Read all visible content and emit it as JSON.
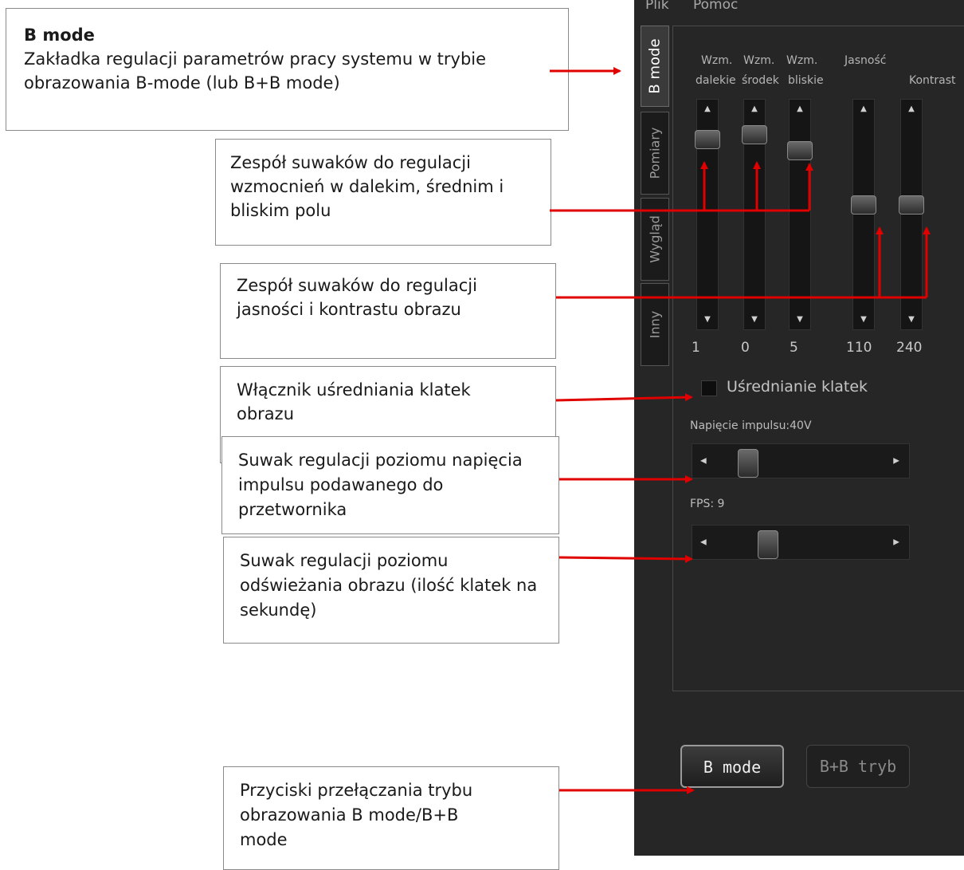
{
  "menu": {
    "file": "Plik",
    "help": "Pomoc"
  },
  "tabs": [
    "B mode",
    "Pomiary",
    "Wygląd",
    "Inny"
  ],
  "sliders": {
    "headers": {
      "far1": "Wzm.",
      "far2": "dalekie",
      "mid1": "Wzm.",
      "mid2": "środek",
      "near1": "Wzm.",
      "near2": "bliskie",
      "brightness": "Jasność",
      "contrast": "Kontrast"
    },
    "values": [
      "1",
      "0",
      "5",
      "110",
      "240"
    ]
  },
  "averaging": {
    "label": "Uśrednianie klatek",
    "checked": false
  },
  "pulse": {
    "label": "Napięcie impulsu:40V"
  },
  "fps": {
    "label": "FPS: 9"
  },
  "buttons": {
    "bmode": "B mode",
    "bbmode": "B+B tryb"
  },
  "callouts": {
    "bmode_title": "B mode",
    "bmode_text": "Zakładka regulacji parametrów pracy systemu w trybie obrazowania B-mode (lub B+B mode)",
    "gain": "Zespół suwaków do regulacji wzmocnień w dalekim, średnim i bliskim polu",
    "bright": "Zespół suwaków do regulacji jasności i kontrastu obrazu",
    "avg": "Włącznik uśredniania klatek obrazu",
    "pulse": "Suwak regulacji poziomu napięcia impulsu podawanego do przetwornika",
    "fps": "Suwak regulacji poziomu odświeżania obrazu (ilość klatek na sekundę)",
    "mode": "Przyciski przełączania trybu obrazowania B mode/B+B mode"
  },
  "colors": {
    "arrow": "#e00000",
    "panel": "#262626"
  }
}
